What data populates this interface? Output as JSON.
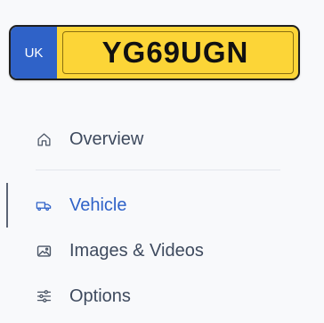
{
  "plate": {
    "country": "UK",
    "registration": "YG69UGN",
    "colors": {
      "plate_yellow": "#fcd537",
      "country_blue": "#2f62c8"
    }
  },
  "nav": {
    "items": [
      {
        "label": "Overview",
        "icon": "home-icon",
        "active": false
      },
      {
        "label": "Vehicle",
        "icon": "car-icon",
        "active": true
      },
      {
        "label": "Images & Videos",
        "icon": "image-icon",
        "active": false
      },
      {
        "label": "Options",
        "icon": "sliders-icon",
        "active": false
      }
    ],
    "colors": {
      "text": "#3e4a5e",
      "active": "#2f62c8"
    }
  }
}
